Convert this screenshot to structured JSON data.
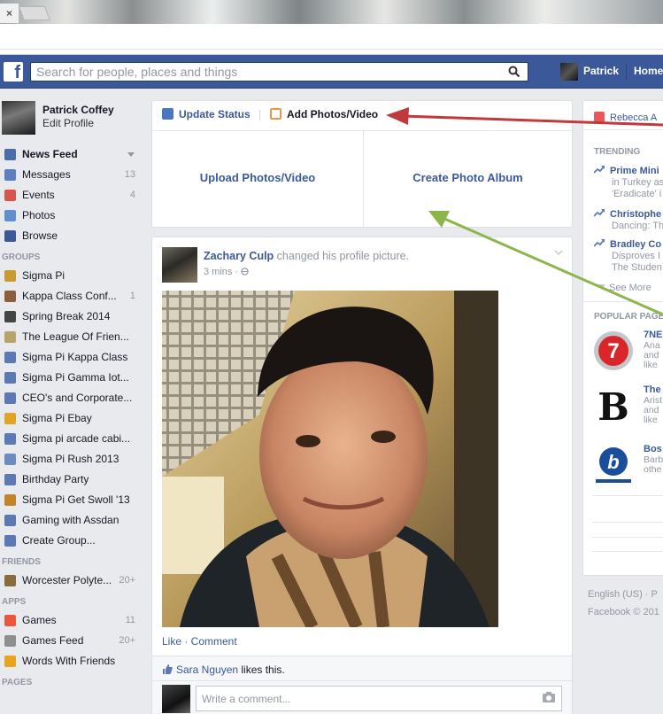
{
  "browser": {
    "tab_close": "×"
  },
  "nav": {
    "logo": "f",
    "search_placeholder": "Search for people, places and things",
    "user_name": "Patrick",
    "home_label": "Home"
  },
  "profile": {
    "name": "Patrick Coffey",
    "edit_label": "Edit Profile"
  },
  "sidebar": {
    "favorites": [
      {
        "label": "News Feed",
        "count": "",
        "icon": "news-feed-icon",
        "color": "#4a6ea9"
      },
      {
        "label": "Messages",
        "count": "13",
        "icon": "messages-icon",
        "color": "#5c7fc1"
      },
      {
        "label": "Events",
        "count": "4",
        "icon": "calendar-icon",
        "color": "#d9534f"
      },
      {
        "label": "Photos",
        "count": "",
        "icon": "photos-icon",
        "color": "#5f8fcf"
      },
      {
        "label": "Browse",
        "count": "",
        "icon": "browse-icon",
        "color": "#3b5998"
      }
    ],
    "groups_header": "GROUPS",
    "groups": [
      {
        "label": "Sigma Pi",
        "count": "",
        "icon": "group-shield-icon",
        "color": "#c99a2e"
      },
      {
        "label": "Kappa Class Conf...",
        "count": "1",
        "icon": "group-photo-icon",
        "color": "#8b5e3c"
      },
      {
        "label": "Spring Break 2014",
        "count": "",
        "icon": "camera-icon",
        "color": "#444444"
      },
      {
        "label": "The League Of Frien...",
        "count": "",
        "icon": "group-pen-icon",
        "color": "#b8a36a"
      },
      {
        "label": "Sigma Pi Kappa Class",
        "count": "",
        "icon": "group-icon",
        "color": "#5b79b4"
      },
      {
        "label": "Sigma Pi Gamma Iot...",
        "count": "",
        "icon": "group-icon",
        "color": "#5b79b4"
      },
      {
        "label": "CEO's and Corporate...",
        "count": "",
        "icon": "group-icon",
        "color": "#5b79b4"
      },
      {
        "label": "Sigma Pi Ebay",
        "count": "",
        "icon": "group-coin-icon",
        "color": "#e0a526"
      },
      {
        "label": "Sigma pi arcade cabi...",
        "count": "",
        "icon": "group-icon",
        "color": "#5b79b4"
      },
      {
        "label": "Sigma Pi Rush 2013",
        "count": "",
        "icon": "group-globe-icon",
        "color": "#6b8cc2"
      },
      {
        "label": "Birthday Party",
        "count": "",
        "icon": "group-icon",
        "color": "#5b79b4"
      },
      {
        "label": "Sigma Pi Get Swoll '13",
        "count": "",
        "icon": "group-dumbbell-icon",
        "color": "#c4822a"
      },
      {
        "label": "Gaming with Assdan",
        "count": "",
        "icon": "group-icon",
        "color": "#5b79b4"
      },
      {
        "label": "Create Group...",
        "count": "",
        "icon": "plus-icon",
        "color": "#5b79b4"
      }
    ],
    "friends_header": "FRIENDS",
    "friends": [
      {
        "label": "Worcester Polyte...",
        "count": "20+",
        "icon": "briefcase-icon",
        "color": "#8b6a3c"
      }
    ],
    "apps_header": "APPS",
    "apps": [
      {
        "label": "Games",
        "count": "11",
        "icon": "games-icon",
        "color": "#e9573f"
      },
      {
        "label": "Games Feed",
        "count": "20+",
        "icon": "games-feed-icon",
        "color": "#8f8f8f"
      },
      {
        "label": "Words With Friends",
        "count": "",
        "icon": "words-with-friends-icon",
        "color": "#e8a321"
      }
    ],
    "pages_header": "PAGES"
  },
  "composer": {
    "update_status": "Update Status",
    "add_photos": "Add Photos/Video",
    "upload": "Upload Photos/Video",
    "create_album": "Create Photo Album"
  },
  "story": {
    "author": "Zachary Culp",
    "action": " changed his profile picture.",
    "time": "3 mins ·",
    "like_comment": "Like · Comment",
    "liker": "Sara Nguyen",
    "likes_suffix": " likes this.",
    "comment_placeholder": "Write a comment..."
  },
  "right": {
    "birthday": "Rebecca A",
    "trending_header": "TRENDING",
    "trending": [
      {
        "title": "Prime Mini",
        "desc": [
          "in Turkey as",
          "'Eradicate' i"
        ]
      },
      {
        "title": "Christophe",
        "desc": [
          "Dancing: Th"
        ]
      },
      {
        "title": "Bradley Co",
        "desc": [
          "Disproves I",
          "The Studen"
        ]
      }
    ],
    "see_more": "See More",
    "popular_header": "POPULAR PAGE",
    "pages": [
      {
        "title": "7NE",
        "desc": "Ana\nand\nlike",
        "icon": "channel-7-logo"
      },
      {
        "title": "The",
        "desc": "Arist\nand\nlike",
        "icon": "boston-globe-logo"
      },
      {
        "title": "Bos",
        "desc": "Barb\nothe",
        "icon": "boston-com-logo"
      }
    ]
  },
  "footer": {
    "line1": "English (US) · P",
    "line2": "Facebook © 201"
  },
  "colors": {
    "facebook_blue": "#3b5998",
    "arrow_red": "#c0393b",
    "arrow_green": "#8cb64c"
  }
}
